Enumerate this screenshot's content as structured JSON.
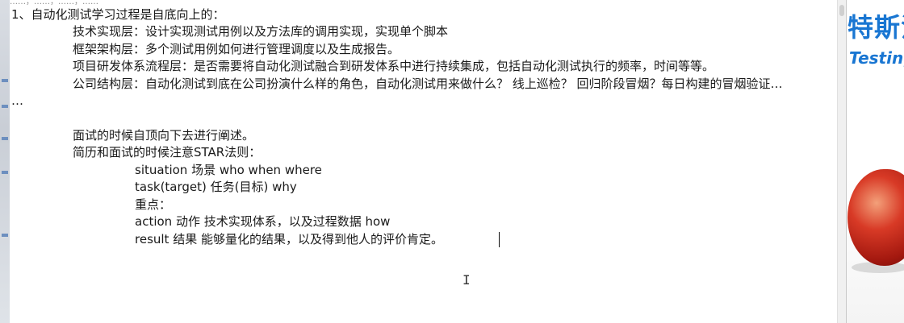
{
  "editor": {
    "top_fragment": "……，……，……，……",
    "lines": [
      "1、自动化测试学习过程是自底向上的：",
      "技术实现层：设计实现测试用例以及方法库的调用实现，实现单个脚本",
      "框架架构层：多个测试用例如何进行管理调度以及生成报告。",
      "项目研发体系流程层：是否需要将自动化测试融合到研发体系中进行持续集成，包括自动化测试执行的频率，时间等等。",
      "公司结构层：自动化测试到底在公司扮演什么样的角色，自动化测试用来做什么？  线上巡检？  回归阶段冒烟？每日构建的冒烟验证…",
      "…",
      "面试的时候自顶向下去进行阐述。",
      "简历和面试的时候注意STAR法则：",
      "situation   场景  who when where",
      "task(target)      任务(目标)    why",
      "重点：",
      "action      动作   技术实现体系，以及过程数据     how",
      "result       结果   能够量化的结果，以及得到他人的评价肯定。"
    ]
  },
  "background": {
    "brand_cn": "特斯汀",
    "brand_en": "Testing"
  }
}
